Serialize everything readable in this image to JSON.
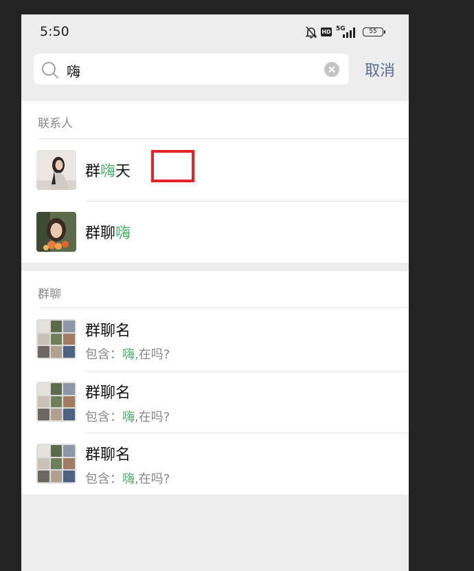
{
  "status_bar": {
    "time": "5:50",
    "network": "5G",
    "battery": "55"
  },
  "search": {
    "query": "嗨",
    "cancel_label": "取消"
  },
  "contacts": {
    "title": "联系人",
    "items": [
      {
        "name_before": "群",
        "name_match": "嗨",
        "name_after": "天"
      },
      {
        "name_before": "群聊",
        "name_match": "嗨",
        "name_after": ""
      }
    ]
  },
  "groups": {
    "title": "群聊",
    "items": [
      {
        "name": "群聊名",
        "sub_prefix": "包含：",
        "sub_match": "嗨",
        "sub_suffix": ",在吗?"
      },
      {
        "name": "群聊名",
        "sub_prefix": "包含：",
        "sub_match": "嗨",
        "sub_suffix": ",在吗?"
      },
      {
        "name": "群聊名",
        "sub_prefix": "包含：",
        "sub_match": "嗨",
        "sub_suffix": ",在吗?"
      }
    ]
  },
  "colors": {
    "highlight": "#4caf6a",
    "cancel": "#576b95",
    "annotation": "#e3242b"
  }
}
